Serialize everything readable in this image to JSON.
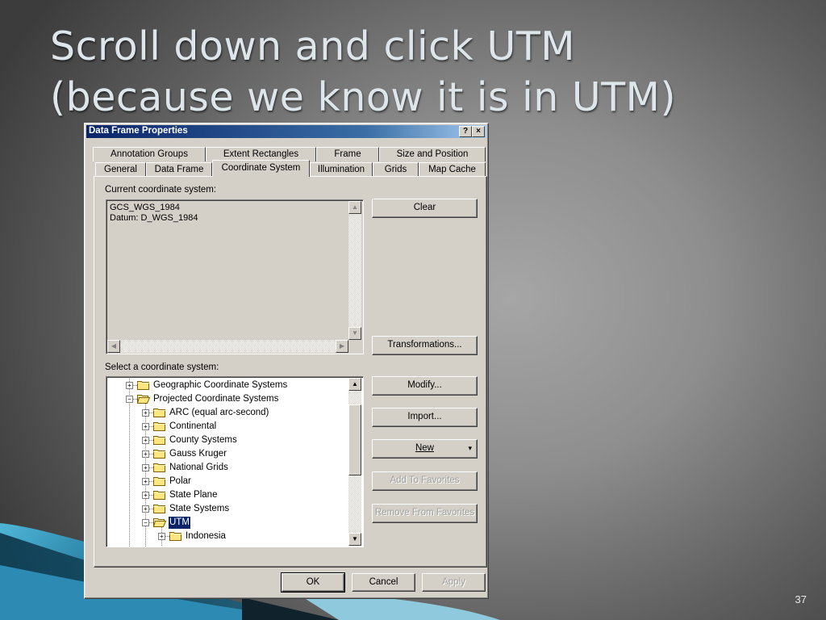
{
  "slide": {
    "title_line1": "Scroll down and click UTM",
    "title_line2": "(because we know it is in UTM)",
    "number": "37"
  },
  "dialog": {
    "title": "Data Frame Properties",
    "help_glyph": "?",
    "close_glyph": "×",
    "tabs_back": [
      "Annotation Groups",
      "Extent Rectangles",
      "Frame",
      "Size and Position"
    ],
    "tabs_front": [
      "General",
      "Data Frame",
      "Coordinate System",
      "Illumination",
      "Grids",
      "Map Cache"
    ],
    "active_tab": "Coordinate System",
    "current_label": "Current coordinate system:",
    "current_text": "GCS_WGS_1984\nDatum: D_WGS_1984",
    "select_label": "Select a coordinate system:",
    "tree": [
      {
        "label": "Geographic Coordinate Systems",
        "level": 1,
        "expanded": false
      },
      {
        "label": "Projected Coordinate Systems",
        "level": 1,
        "expanded": true
      },
      {
        "label": "ARC (equal arc-second)",
        "level": 2,
        "expanded": false
      },
      {
        "label": "Continental",
        "level": 2,
        "expanded": false
      },
      {
        "label": "County Systems",
        "level": 2,
        "expanded": false
      },
      {
        "label": "Gauss Kruger",
        "level": 2,
        "expanded": false
      },
      {
        "label": "National Grids",
        "level": 2,
        "expanded": false
      },
      {
        "label": "Polar",
        "level": 2,
        "expanded": false
      },
      {
        "label": "State Plane",
        "level": 2,
        "expanded": false
      },
      {
        "label": "State Systems",
        "level": 2,
        "expanded": false
      },
      {
        "label": "UTM",
        "level": 2,
        "expanded": true,
        "selected": true
      },
      {
        "label": "Indonesia",
        "level": 3,
        "expanded": false
      }
    ],
    "buttons": {
      "clear": "Clear",
      "transformations": "Transformations...",
      "modify": "Modify...",
      "import": "Import...",
      "new": "New",
      "new_arrow": "▾",
      "add_favorites": "Add To Favorites",
      "remove_favorites": "Remove From Favorites",
      "ok": "OK",
      "cancel": "Cancel",
      "apply": "Apply"
    }
  }
}
